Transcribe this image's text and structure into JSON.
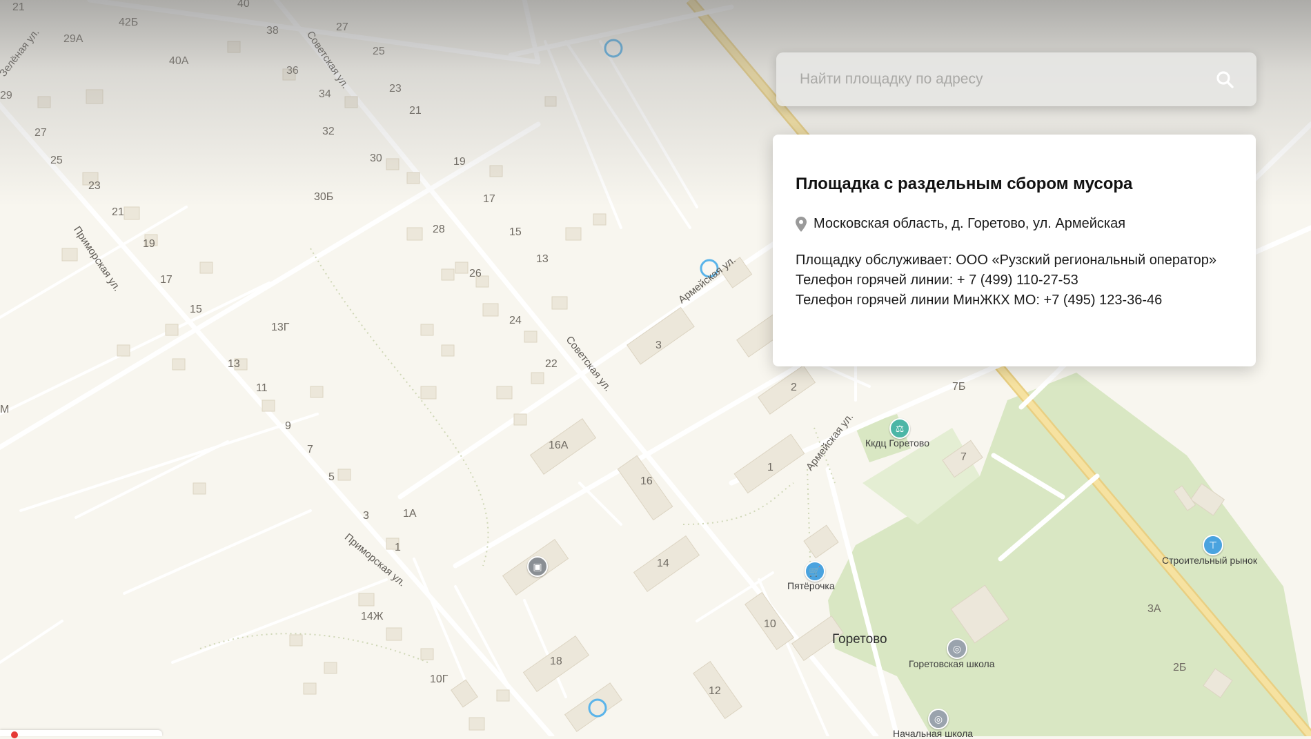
{
  "search": {
    "placeholder": "Найти площадку по адресу"
  },
  "card": {
    "title": "Площадка с раздельным сбором мусора",
    "address": "Московская область, д. Горетово, ул. Армейская",
    "operator": "Площадку обслуживает: ООО «Рузский региональный оператор»",
    "hotline": "Телефон горячей линии: + 7 (499) 110-27-53",
    "ministry_hotline": "Телефон горячей линии МинЖКХ МО: +7 (495) 123-36-46"
  },
  "map": {
    "streets": {
      "sovetskaya_1": "Советская ул.",
      "sovetskaya_2": "Советская ул.",
      "primorskaya_1": "Приморская ул.",
      "primorskaya_2": "Приморская ул.",
      "armeyskaya_1": "Армейская ул.",
      "armeyskaya_2": "Армейская ул.",
      "zelenaya": "Зелёная ул."
    },
    "places": {
      "kkdc": "Ккдц Горетово",
      "pyaterochka": "Пятёрочка",
      "stroitelny": "Строительный рынок",
      "goretovo": "Горетово",
      "school": "Горетовская школа",
      "primary_school": "Начальная школа"
    },
    "house_numbers": [
      "21",
      "40",
      "42Б",
      "38",
      "27",
      "29А",
      "40А",
      "25",
      "36",
      "23",
      "34",
      "21",
      "29",
      "32",
      "27",
      "30",
      "25",
      "19",
      "30Б",
      "23",
      "17",
      "21",
      "28",
      "15",
      "19",
      "13",
      "17",
      "26",
      "15",
      "13Г",
      "24",
      "13",
      "22",
      "3",
      "11",
      "2",
      "7Б",
      "9",
      "16А",
      "1",
      "7",
      "7",
      "16",
      "5",
      "3",
      "1А",
      "1",
      "14",
      "14Ж",
      "10",
      "18",
      "10Г",
      "12",
      "3А",
      "2Б",
      "М"
    ],
    "colors": {
      "background": "#f8f6ef",
      "road": "#ffffff",
      "highway": "#f3d98a",
      "park": "#d9e7c3",
      "building": "#ece7da",
      "ring": "#5ab4ea"
    }
  }
}
